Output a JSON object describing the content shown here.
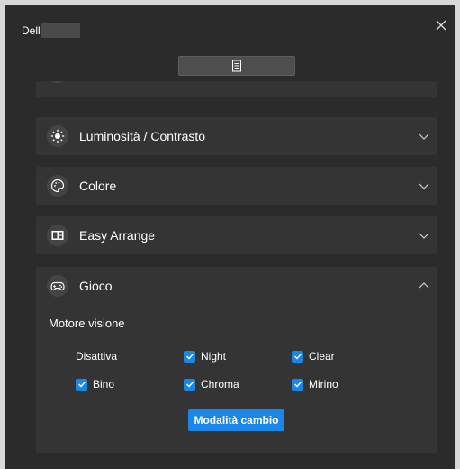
{
  "window": {
    "title": "Dell"
  },
  "panels": [
    {
      "title": "Luminosità / Contrasto",
      "icon": "brightness-icon"
    },
    {
      "title": "Colore",
      "icon": "color-palette-icon"
    },
    {
      "title": "Easy Arrange",
      "icon": "easy-arrange-icon"
    },
    {
      "title": "Gioco",
      "icon": "gamepad-icon"
    }
  ],
  "game": {
    "section_title": "Motore visione",
    "options": [
      {
        "label": "Disattiva",
        "checked": false
      },
      {
        "label": "Night",
        "checked": true
      },
      {
        "label": "Clear",
        "checked": true
      },
      {
        "label": "Bino",
        "checked": true
      },
      {
        "label": "Chroma",
        "checked": true
      },
      {
        "label": "Mirino",
        "checked": true
      }
    ],
    "button_label": "Modalità cambio"
  },
  "colors": {
    "accent": "#1a86e8",
    "background": "#2b2b2b",
    "panel": "#343434"
  }
}
